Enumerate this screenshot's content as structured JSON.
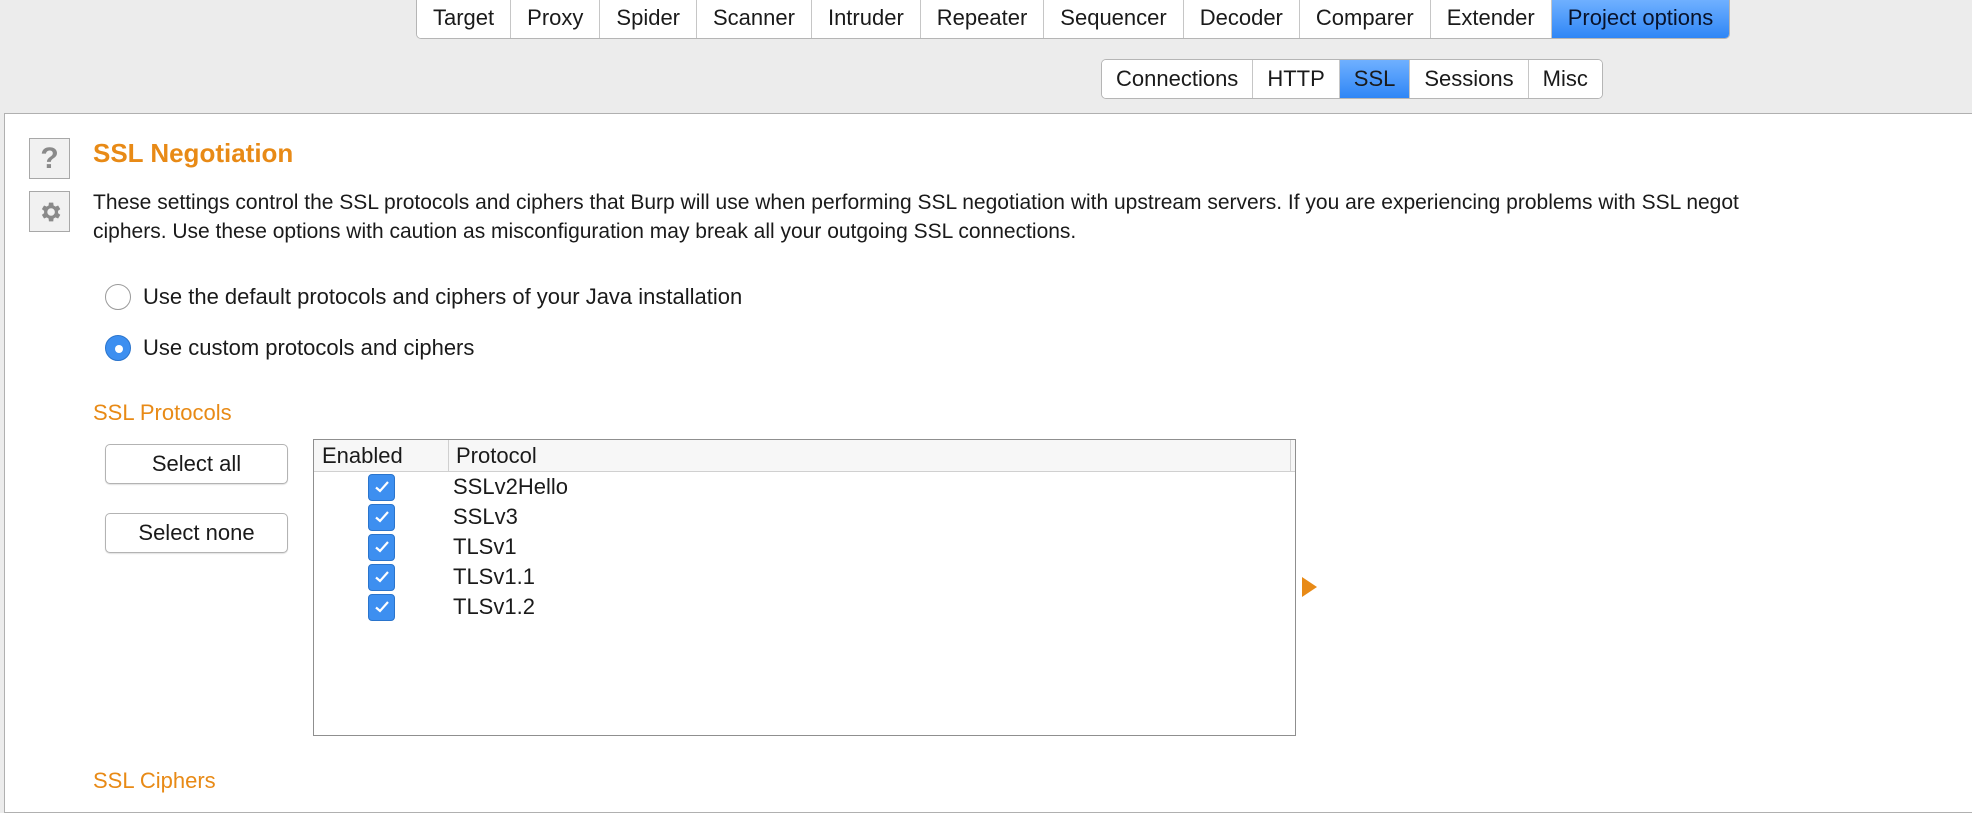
{
  "top_tabs": [
    {
      "label": "Target"
    },
    {
      "label": "Proxy"
    },
    {
      "label": "Spider"
    },
    {
      "label": "Scanner"
    },
    {
      "label": "Intruder"
    },
    {
      "label": "Repeater"
    },
    {
      "label": "Sequencer"
    },
    {
      "label": "Decoder"
    },
    {
      "label": "Comparer"
    },
    {
      "label": "Extender"
    },
    {
      "label": "Project options",
      "active": true
    }
  ],
  "sub_tabs": [
    {
      "label": "Connections"
    },
    {
      "label": "HTTP"
    },
    {
      "label": "SSL",
      "active": true
    },
    {
      "label": "Sessions"
    },
    {
      "label": "Misc"
    }
  ],
  "section": {
    "help_glyph": "?",
    "title": "SSL Negotiation",
    "description_line1": "These settings control the SSL protocols and ciphers that Burp will use when performing SSL negotiation with upstream servers. If you are experiencing problems with SSL negot",
    "description_line2": "ciphers. Use these options with caution as misconfiguration may break all your outgoing SSL connections."
  },
  "radio_options": [
    {
      "label": "Use the default protocols and ciphers of your Java installation",
      "checked": false
    },
    {
      "label": "Use custom protocols and ciphers",
      "checked": true
    }
  ],
  "protocols": {
    "title": "SSL Protocols",
    "select_all_label": "Select all",
    "select_none_label": "Select none",
    "columns": {
      "enabled": "Enabled",
      "protocol": "Protocol"
    },
    "rows": [
      {
        "enabled": true,
        "protocol": "SSLv2Hello"
      },
      {
        "enabled": true,
        "protocol": "SSLv3"
      },
      {
        "enabled": true,
        "protocol": "TLSv1"
      },
      {
        "enabled": true,
        "protocol": "TLSv1.1"
      },
      {
        "enabled": true,
        "protocol": "TLSv1.2"
      }
    ]
  },
  "ciphers": {
    "title": "SSL Ciphers"
  },
  "colors": {
    "accent": "#e88a16",
    "active_tab": "#3d8ff0"
  }
}
